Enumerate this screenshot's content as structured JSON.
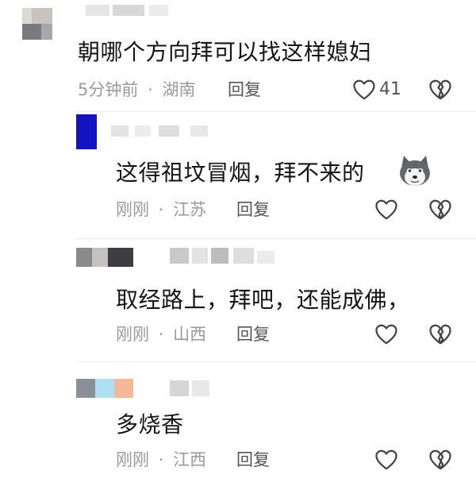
{
  "comments": [
    {
      "text": "朝哪个方向拜可以找这样媳妇",
      "time": "5分钟前",
      "location": "湖南",
      "reply_label": "回复",
      "like_count": "41"
    },
    {
      "text": "这得祖坟冒烟，拜不来的",
      "time": "刚刚",
      "location": "江苏",
      "reply_label": "回复",
      "emoji": "husky-dog-emoji"
    },
    {
      "text": "取经路上，拜吧，还能成佛，",
      "time": "刚刚",
      "location": "山西",
      "reply_label": "回复"
    },
    {
      "text": "多烧香",
      "time": "刚刚",
      "location": "江西",
      "reply_label": "回复"
    }
  ],
  "separator": "·",
  "icons": {
    "like": "heart-outline-icon",
    "dislike": "broken-heart-icon"
  },
  "colors": {
    "text": "#151515",
    "meta": "#9a9a9a",
    "icon": "#444444"
  }
}
